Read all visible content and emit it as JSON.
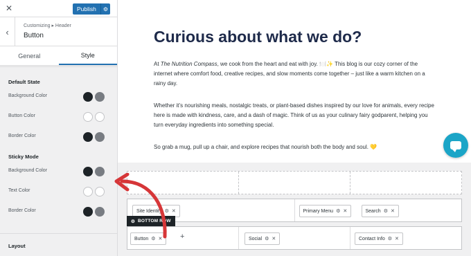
{
  "topbar": {
    "close_icon": "close-icon",
    "publish_label": "Publish",
    "publish_gear_icon": "gear-icon"
  },
  "section": {
    "back_icon": "chevron-left-icon",
    "breadcrumb": "Customizing ▸ Header",
    "title": "Button"
  },
  "tabs": [
    {
      "label": "General",
      "active": false
    },
    {
      "label": "Style",
      "active": true
    }
  ],
  "default_state": {
    "title": "Default State",
    "rows": [
      {
        "label": "Background Color",
        "colors": [
          "#1d2327",
          "#787c82"
        ]
      },
      {
        "label": "Button Color",
        "colors": [
          "#ffffff",
          "#ffffff"
        ]
      },
      {
        "label": "Border Color",
        "colors": [
          "#1d2327",
          "#787c82"
        ]
      }
    ]
  },
  "sticky_mode": {
    "title": "Sticky Mode",
    "rows": [
      {
        "label": "Background Color",
        "colors": [
          "#1d2327",
          "#787c82"
        ]
      },
      {
        "label": "Text Color",
        "colors": [
          "#ffffff",
          "#ffffff"
        ]
      },
      {
        "label": "Border Color",
        "colors": [
          "#1d2327",
          "#787c82"
        ]
      }
    ]
  },
  "layout_title": "Layout",
  "preview": {
    "heading": "Curious about what we do?",
    "p1_a": "At ",
    "p1_brand": "The Nutrition Compass",
    "p1_b": ", we cook from the heart and eat with joy. 🍽️✨ This blog is our cozy corner of the internet where comfort food, creative recipes, and slow moments come together – just like a warm kitchen on a rainy day.",
    "p2": "Whether it’s nourishing meals, nostalgic treats, or plant-based dishes inspired by our love for animals, every recipe here is made with kindness, care, and a dash of magic. Think of us as your culinary fairy godparent, helping you turn everyday ingredients into something special.",
    "p3": "So grab a mug, pull up a chair, and explore recipes that nourish both the body and soul. 💛",
    "chat_icon": "chat-bubble-icon"
  },
  "builder": {
    "main_row": [
      "Site Identity",
      "Primary Menu",
      "Search"
    ],
    "bottom_row_tag": "BOTTOM ROW",
    "bottom_row": [
      "Button",
      "Social",
      "Contact Info"
    ],
    "accent_color": "#d63638"
  }
}
